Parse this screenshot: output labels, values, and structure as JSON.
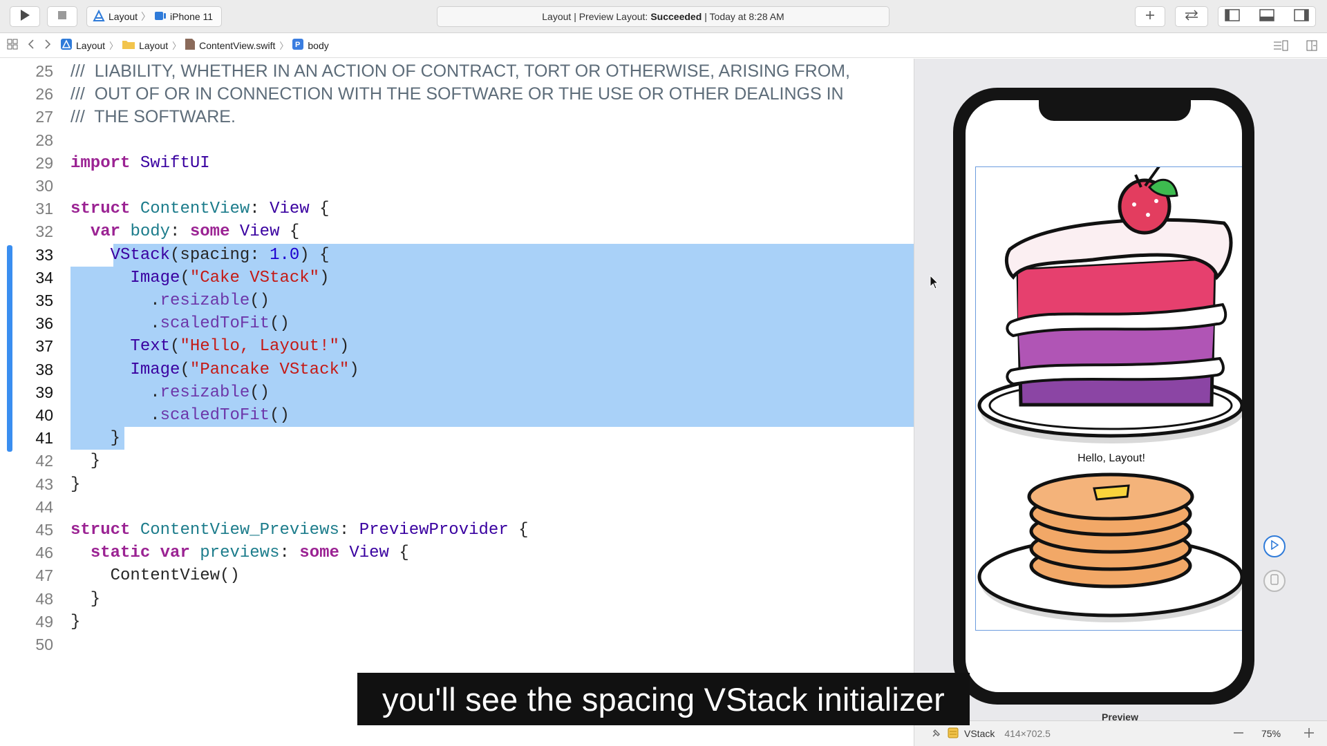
{
  "toolbar": {
    "scheme_project": "Layout",
    "scheme_device": "iPhone 11",
    "status_prefix": "Layout | Preview Layout:",
    "status_result": "Succeeded",
    "status_suffix": "| Today at 8:28 AM"
  },
  "jumpbar": {
    "crumbs": [
      "Layout",
      "Layout",
      "ContentView.swift",
      "body"
    ]
  },
  "editor": {
    "lines": [
      {
        "n": "25",
        "t": "///  LIABILITY, WHETHER IN AN ACTION OF CONTRACT, TORT OR OTHERWISE, ARISING FROM,"
      },
      {
        "n": "26",
        "t": "///  OUT OF OR IN CONNECTION WITH THE SOFTWARE OR THE USE OR OTHER DEALINGS IN"
      },
      {
        "n": "27",
        "t": "///  THE SOFTWARE."
      },
      {
        "n": "28",
        "t": ""
      },
      {
        "n": "29",
        "t": "import SwiftUI"
      },
      {
        "n": "30",
        "t": ""
      },
      {
        "n": "31",
        "t": "struct ContentView: View {"
      },
      {
        "n": "32",
        "t": "  var body: some View {"
      },
      {
        "n": "33",
        "t": "    VStack(spacing: 1.0) {"
      },
      {
        "n": "34",
        "t": "      Image(\"Cake VStack\")"
      },
      {
        "n": "35",
        "t": "        .resizable()"
      },
      {
        "n": "36",
        "t": "        .scaledToFit()"
      },
      {
        "n": "37",
        "t": "      Text(\"Hello, Layout!\")"
      },
      {
        "n": "38",
        "t": "      Image(\"Pancake VStack\")"
      },
      {
        "n": "39",
        "t": "        .resizable()"
      },
      {
        "n": "40",
        "t": "        .scaledToFit()"
      },
      {
        "n": "41",
        "t": "    }"
      },
      {
        "n": "42",
        "t": "  }"
      },
      {
        "n": "43",
        "t": "}"
      },
      {
        "n": "44",
        "t": ""
      },
      {
        "n": "45",
        "t": "struct ContentView_Previews: PreviewProvider {"
      },
      {
        "n": "46",
        "t": "  static var previews: some View {"
      },
      {
        "n": "47",
        "t": "    ContentView()"
      },
      {
        "n": "48",
        "t": "  }"
      },
      {
        "n": "49",
        "t": "}"
      },
      {
        "n": "50",
        "t": ""
      }
    ]
  },
  "preview": {
    "hello_text": "Hello, Layout!",
    "label": "Preview",
    "selected_view": "VStack",
    "view_size": "414×702.5",
    "zoom": "75%"
  },
  "caption": "you'll see the spacing VStack initializer",
  "colors": {
    "selection": "#a9d1f8",
    "gutter_bar": "#3a8ef0",
    "keyword": "#9b2393",
    "string": "#c41a16",
    "number": "#1c00cf"
  }
}
